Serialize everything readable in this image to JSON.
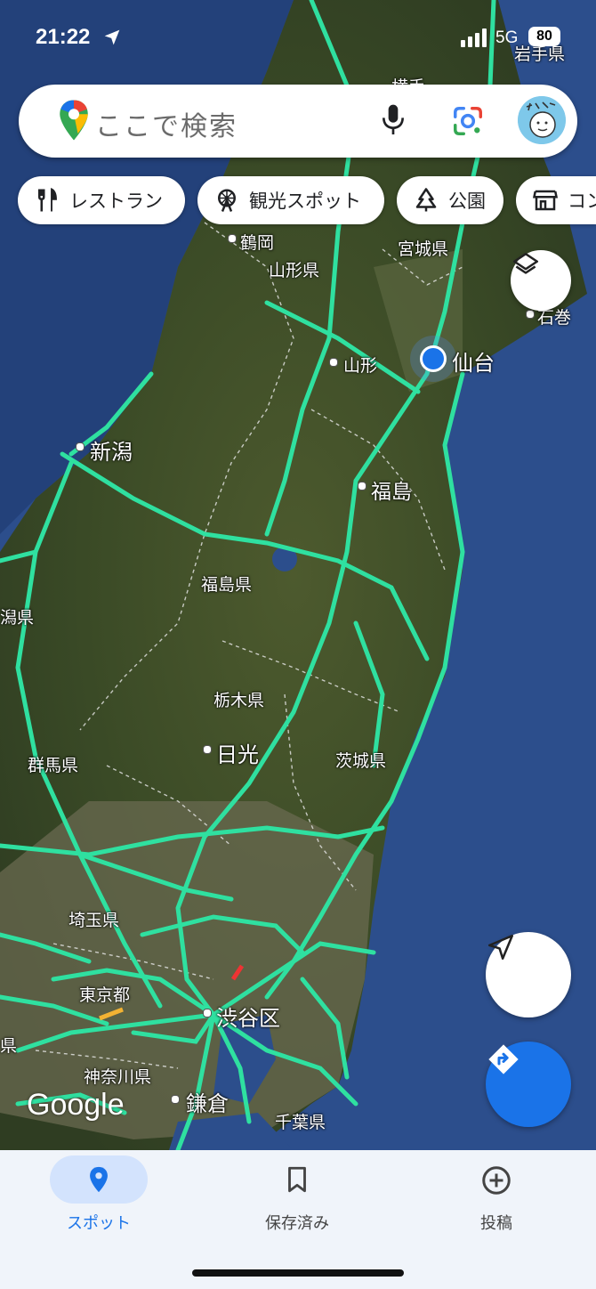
{
  "status_bar": {
    "time": "21:22",
    "network": "5G",
    "battery": "80"
  },
  "search": {
    "placeholder": "ここで検索"
  },
  "chips": [
    {
      "label": "レストラン",
      "icon": "fork-knife-icon"
    },
    {
      "label": "観光スポット",
      "icon": "ferris-wheel-icon"
    },
    {
      "label": "公園",
      "icon": "tree-icon"
    },
    {
      "label": "コン",
      "icon": "store-icon"
    }
  ],
  "map": {
    "logo": "Google",
    "labels": {
      "iwate": "岩手県",
      "yokote": "横手",
      "tsuruoka": "鶴岡",
      "yamagata_pref": "山形県",
      "miyagi_pref": "宮城県",
      "ishinomaki": "石巻",
      "yamagata": "山形",
      "sendai": "仙台",
      "niigata": "新潟",
      "fukushima": "福島",
      "fukushima_pref": "福島県",
      "niigata_pref_edge": "潟県",
      "tochigi_pref": "栃木県",
      "nikko": "日光",
      "gunma_pref": "群馬県",
      "ibaraki_pref": "茨城県",
      "saitama_pref": "埼玉県",
      "tokyo": "東京都",
      "shibuya": "渋谷区",
      "kanagawa_pref": "神奈川県",
      "kamakura": "鎌倉",
      "chiba_pref": "千葉県",
      "edge_ken": "県"
    }
  },
  "bottom_nav": {
    "tabs": [
      {
        "label": "スポット",
        "icon": "location-pin-icon",
        "active": true
      },
      {
        "label": "保存済み",
        "icon": "bookmark-icon",
        "active": false
      },
      {
        "label": "投稿",
        "icon": "add-circle-icon",
        "active": false
      }
    ]
  },
  "colors": {
    "accent": "#1a73e8",
    "traffic_green": "#2fe0a0",
    "active_pill": "#d3e3fd"
  }
}
